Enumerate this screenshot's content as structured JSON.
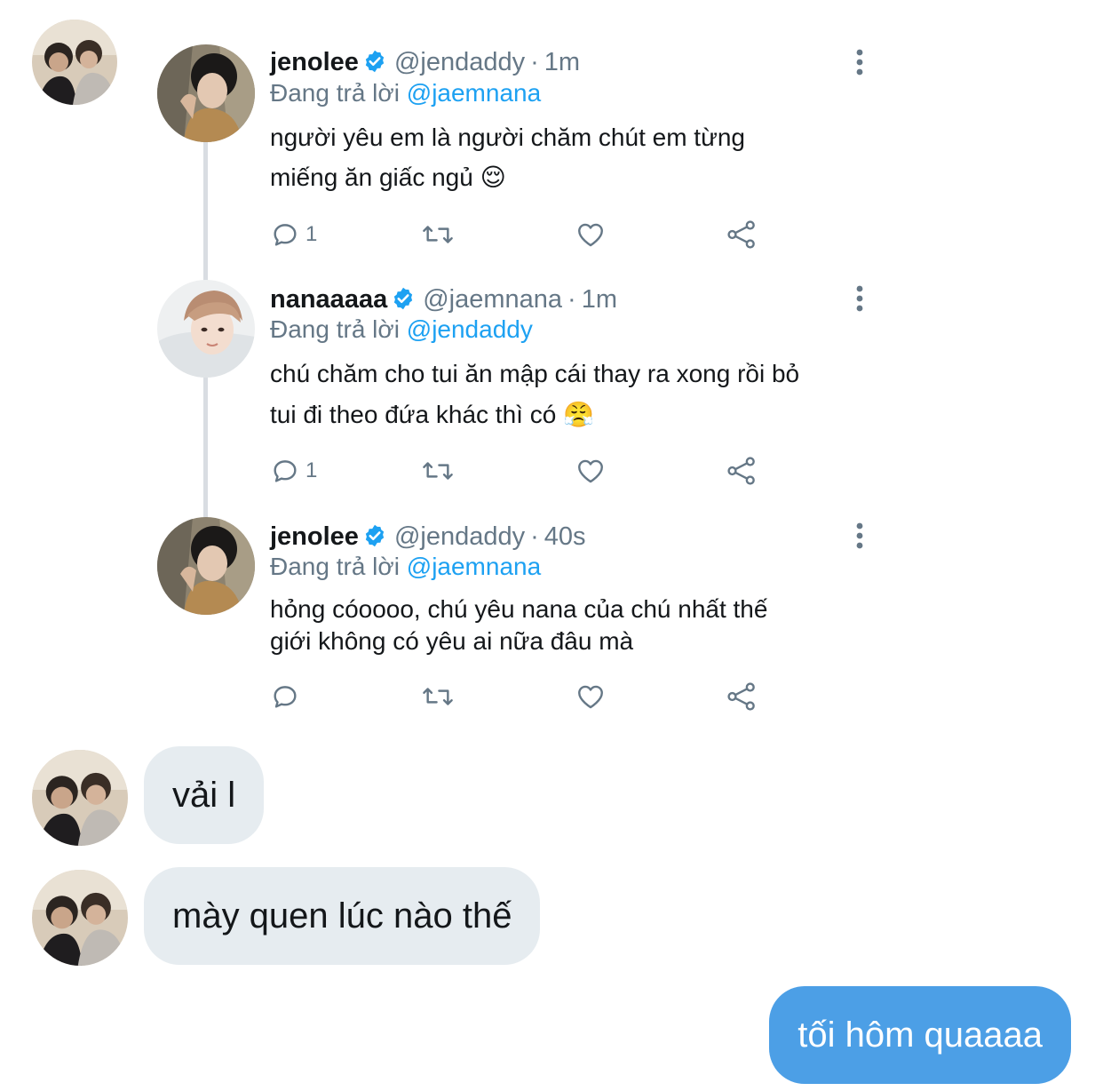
{
  "conversation_partner": {
    "avatar": "couple-photo-avatar"
  },
  "tweets": [
    {
      "display_name": "jenolee",
      "handle": "@jendaddy",
      "time": "1m",
      "reply_prefix": "Đang trả lời",
      "reply_mention": "@jaemnana",
      "text_line1": "người yêu em là người chăm chút em từng",
      "text_line2": "miếng ăn giấc ngủ 😌",
      "reply_count": "1",
      "avatar": "dark-hair-avatar"
    },
    {
      "display_name": "nanaaaaa",
      "handle": "@jaemnana",
      "time": "1m",
      "reply_prefix": "Đang trả lời",
      "reply_mention": "@jendaddy",
      "text_line1": "chú chăm cho tui ăn mập cái thay ra xong rồi bỏ",
      "text_line2": "tui đi theo đứa khác thì có 😤",
      "reply_count": "1",
      "avatar": "light-hair-avatar"
    },
    {
      "display_name": "jenolee",
      "handle": "@jendaddy",
      "time": "40s",
      "reply_prefix": "Đang trả lời",
      "reply_mention": "@jaemnana",
      "text_line1": "hỏng cóoooo, chú yêu nana của chú nhất thế",
      "text_line2": "giới không có yêu ai nữa đâu mà",
      "reply_count": "",
      "avatar": "dark-hair-avatar"
    }
  ],
  "messages": [
    {
      "direction": "incoming",
      "text": "vải l"
    },
    {
      "direction": "incoming",
      "text": "mày quen lúc nào thế"
    },
    {
      "direction": "outgoing",
      "text": "tối hôm quaaaa"
    }
  ],
  "colors": {
    "accent": "#1da1f2",
    "secondary_text": "#657786",
    "incoming_bubble": "#e6ecf0",
    "outgoing_bubble": "#4c9fe6",
    "thread_line": "#d9dde2"
  }
}
